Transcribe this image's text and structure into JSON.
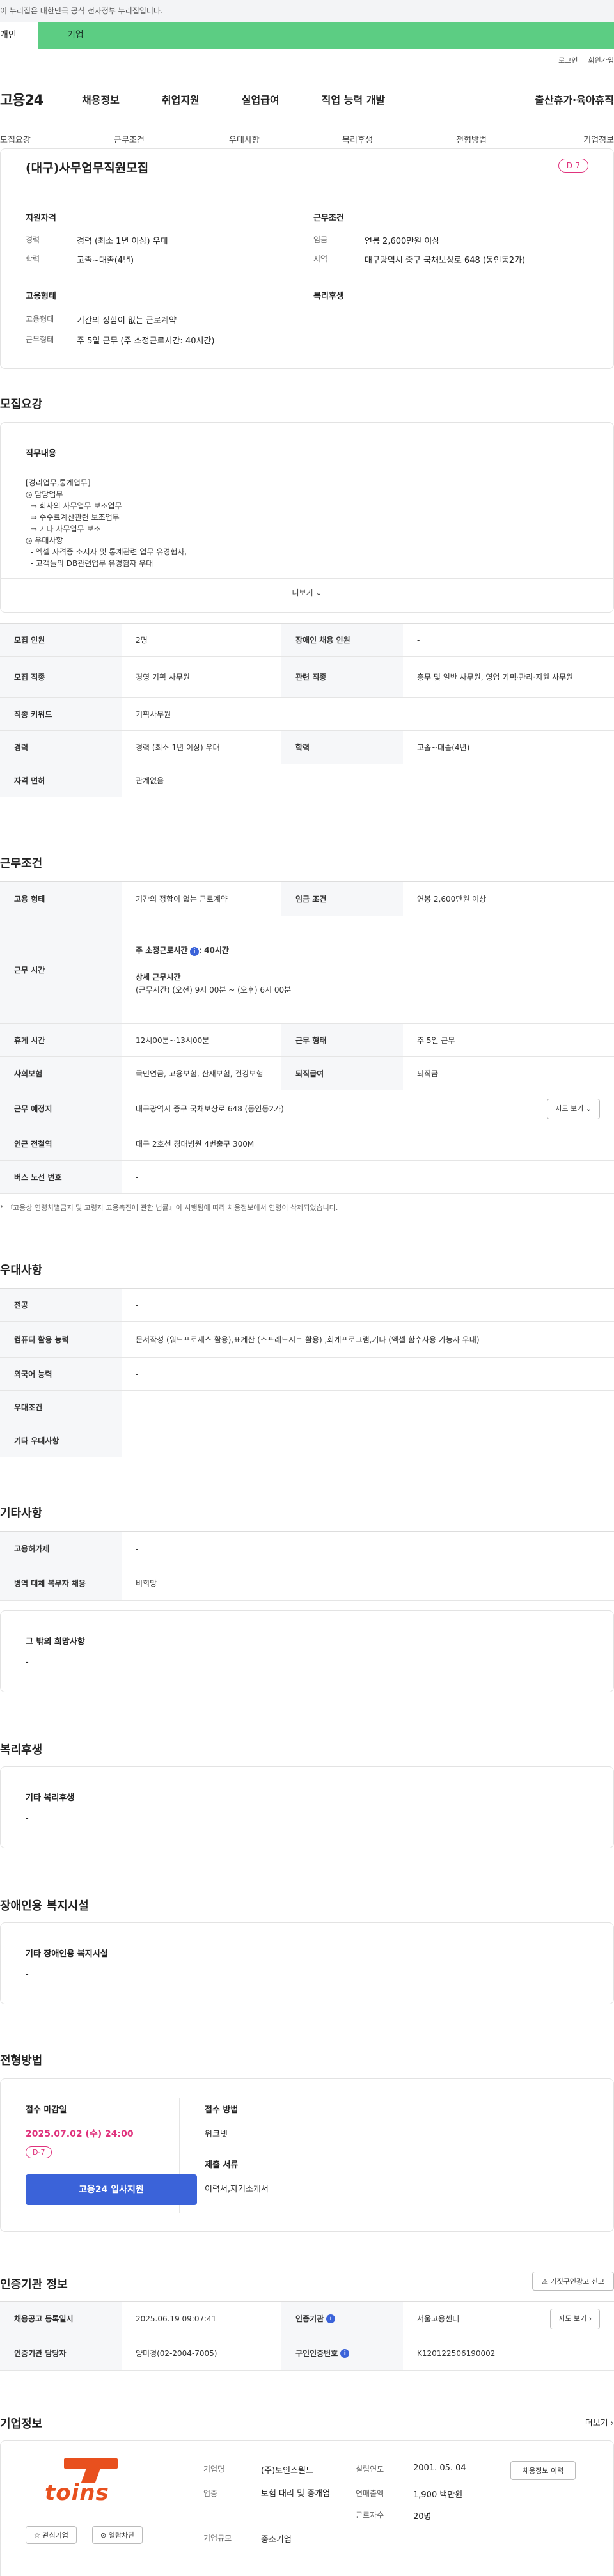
{
  "banner": {
    "text": "이 누리집은 대한민국 공식 전자정부 누리집입니다.",
    "tab_personal": "개인",
    "tab_company": "기업"
  },
  "util": {
    "login": "로그인",
    "join": "회원가입"
  },
  "gnb": {
    "logo": "고용24",
    "menu": [
      "채용정보",
      "취업지원",
      "실업급여",
      "직업 능력 개발",
      "출산휴가·육아휴직"
    ]
  },
  "lnb": [
    "모집요강",
    "근무조건",
    "우대사항",
    "복리후생",
    "전형방법",
    "기업정보"
  ],
  "summary": {
    "title": "(대구)사무업무직원모집",
    "dday": "D-7",
    "qual_heading": "지원자격",
    "career_lbl": "경력",
    "career_val": "경력 (최소 1년 이상) 우대",
    "edu_lbl": "학력",
    "edu_val": "고졸~대졸(4년)",
    "cond_heading": "근무조건",
    "wage_lbl": "임금",
    "wage_val": "연봉 2,600만원 이상",
    "region_lbl": "지역",
    "region_val": "대구광역시 중구 국채보상로 648 (동인동2가)",
    "emp_heading": "고용형태",
    "emptype_lbl": "고용형태",
    "emptype_val": "기간의 정함이 없는 근로계약",
    "worktype_lbl": "근무형태",
    "worktype_val": "주 5일 근무 (주 소정근로시간: 40시간)",
    "welfare_heading": "복리후생"
  },
  "recruit": {
    "heading": "모집요강",
    "job_heading": "직무내용",
    "job_lines": [
      "[경리업무,통계업무]",
      "◎ 담당업무",
      "  ⇒ 회사의 사무업무 보조업무",
      "  ⇒ 수수료계산관련 보조업무",
      "  ⇒ 기타 사무업무 보조",
      "◎ 우대사항",
      "  - 엑셀 자격증 소지자 및 통계관련 업무 유경험자,",
      "  - 고객들의 DB관련업무 유경험자 우대"
    ],
    "more": "더보기",
    "rows": [
      [
        "모집 인원",
        "2명",
        "장애인 채용 인원",
        "-"
      ],
      [
        "모집 직종",
        "경영 기획 사무원",
        "관련 직종",
        "총무 및 일반 사무원, 영업 기획·관리·지원 사무원"
      ],
      [
        "직종 키워드",
        "기획사무원",
        "",
        ""
      ],
      [
        "경력",
        "경력 (최소 1년 이상) 우대",
        "학력",
        "고졸~대졸(4년)"
      ],
      [
        "자격 면허",
        "관계없음",
        "",
        ""
      ]
    ]
  },
  "work": {
    "heading": "근무조건",
    "r1": [
      "고용 형태",
      "기간의 정함이 없는 근로계약",
      "임금 조건",
      "연봉 2,600만원 이상"
    ],
    "hours_lbl": "근무 시간",
    "hours_main": "주 소정근로시간",
    "hours_main_val": "40시간",
    "hours_detail": "상세 근무시간",
    "hours_detail_val": "(근무시간) (오전) 9시 00분 ~ (오후) 6시 00분",
    "rows": [
      [
        "휴게 시간",
        "12시00분~13시00분",
        "근무 형태",
        "주 5일 근무"
      ],
      [
        "사회보험",
        "국민연금, 고용보험, 산재보험, 건강보험",
        "퇴직급여",
        "퇴직금"
      ]
    ],
    "place_lbl": "근무 예정지",
    "place_val": "대구광역시 중구 국채보상로 648 (동인동2가)",
    "map_btn": "지도 보기",
    "subway_lbl": "인근 전철역",
    "subway_val": "대구 2호선 경대병원 4번출구 300M",
    "bus_lbl": "버스 노선 번호",
    "bus_val": "-",
    "note": "* 『고용상 연령차별금지 및 고령자 고용촉진에 관한 법률』이 시행됨에 따라 채용정보에서 연령이 삭제되었습니다."
  },
  "pref": {
    "heading": "우대사항",
    "rows": [
      [
        "전공",
        "-"
      ],
      [
        "컴퓨터 활용 능력",
        "문서작성 (워드프로세스 활용),표계산 (스프레드시트 활용) ,회계프로그램,기타 (엑셀 함수사용 가능자 우대)"
      ],
      [
        "외국어 능력",
        "-"
      ],
      [
        "우대조건",
        "-"
      ],
      [
        "기타 우대사항",
        "-"
      ]
    ]
  },
  "etc": {
    "heading": "기타사항",
    "rows": [
      [
        "고용허가제",
        "-"
      ],
      [
        "병역 대체 복무자 채용",
        "비희망"
      ]
    ],
    "other_heading": "그 밖의 희망사항",
    "other_val": "-"
  },
  "welfare": {
    "heading": "복리후생",
    "label": "기타 복리후생",
    "val": "-"
  },
  "disabled": {
    "heading": "장애인용 복지시설",
    "label": "기타 장애인용 복지시설",
    "val": "-"
  },
  "process": {
    "heading": "전형방법",
    "deadline_lbl": "접수 마감일",
    "deadline_val": "2025.07.02 (수) 24:00",
    "dday": "D-7",
    "apply_btn": "고용24 입사지원",
    "method_lbl": "접수 방법",
    "method_val": "워크넷",
    "docs_lbl": "제출 서류",
    "docs_val": "이력서,자기소개서"
  },
  "cert": {
    "heading": "인증기관 정보",
    "report_btn": "거짓구인광고 신고",
    "rows": [
      [
        "채용공고 등록일시",
        "2025.06.19 09:07:41",
        "인증기관",
        "서울고용센터"
      ],
      [
        "인증기관 담당자",
        "양미경(02-2004-7005)",
        "구인인증번호",
        "K120122506190002"
      ]
    ],
    "map_btn": "지도 보기"
  },
  "company": {
    "heading": "기업정보",
    "more": "더보기",
    "name_lbl": "기업명",
    "name_val": "(주)토인스윌드",
    "industry_lbl": "업종",
    "industry_val": "보험 대리 및 중개업",
    "scale_lbl": "기업규모",
    "scale_val": "중소기업",
    "founded_lbl": "설립연도",
    "founded_val": "2001. 05. 04",
    "sales_lbl": "연매출액",
    "sales_val": "1,900 백만원",
    "staff_lbl": "근로자수",
    "staff_val": "20명",
    "history_btn": "채용정보 이력",
    "fav_btn": "관심기업",
    "block_btn": "열람차단",
    "logo_text": "toins"
  }
}
